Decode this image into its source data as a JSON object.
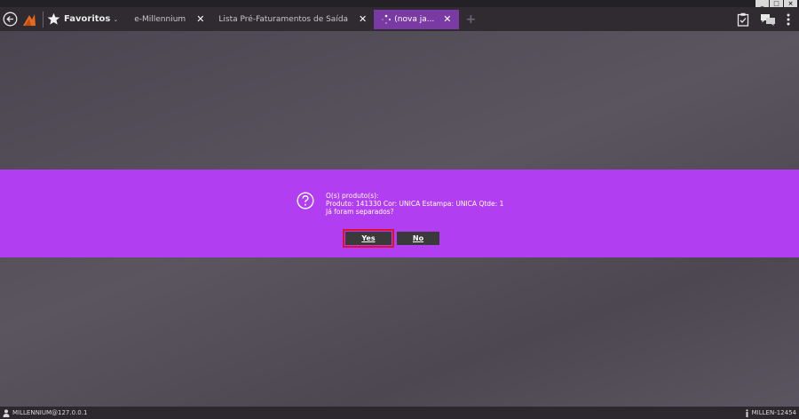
{
  "window": {
    "controls": [
      "_",
      "□",
      "×"
    ]
  },
  "toolbar": {
    "favorites_label": "Favoritos",
    "favorites_chevron": "⌄",
    "add_tab": "+"
  },
  "tabs": [
    {
      "title": "e-Millennium",
      "close": "✕"
    },
    {
      "title": "Lista Pré-Faturamentos de Saída",
      "close": "✕"
    },
    {
      "title": "(nova ja...",
      "close": "✕"
    }
  ],
  "dialog": {
    "line1": "O(s) produto(s):",
    "line2": "Produto: 141330 Cor: UNICA Estampa: UNICA Qtde: 1",
    "line3": "Já foram separados?",
    "yes_label": "Yes",
    "no_label": "No"
  },
  "statusbar": {
    "left": "MILLENNIUM@127.0.0.1",
    "right": "MILLEN-12454"
  },
  "colors": {
    "accent": "#b13ef0",
    "active_tab": "#7a3aa3",
    "highlight": "#e0112d"
  }
}
